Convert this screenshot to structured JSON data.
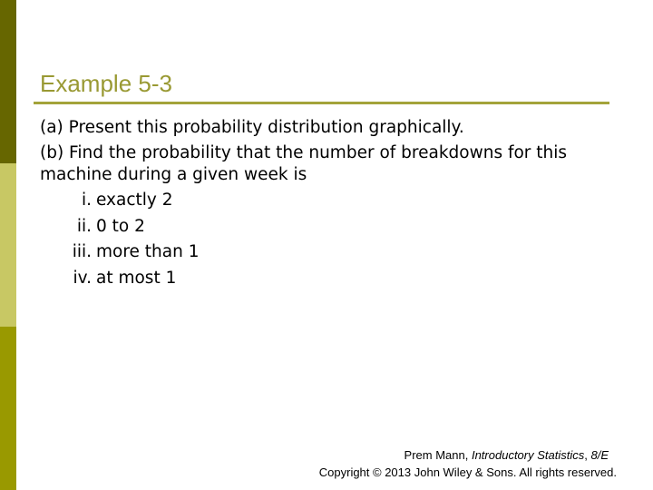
{
  "slide": {
    "title": "Example 5-3",
    "colors": {
      "bar_top": "#666600",
      "bar_middle": "#c8c864",
      "bar_bottom": "#999900",
      "title": "#999933",
      "rule": "#a3a33a"
    },
    "parts": {
      "a": "(a) Present this probability distribution graphically.",
      "b_line1": "(b) Find the probability that the number of breakdowns for this",
      "b_line2": "machine during a given week is"
    },
    "sub_items": [
      {
        "num": "i.",
        "text": "exactly 2"
      },
      {
        "num": "ii.",
        "text": "0 to 2"
      },
      {
        "num": "iii.",
        "text": "more than 1"
      },
      {
        "num": "iv.",
        "text": "at most 1"
      }
    ],
    "footer": {
      "author": "Prem Mann, ",
      "book": "Introductory Statistics",
      "sep": ", ",
      "edition": "8/E",
      "copyright": "Copyright © 2013 John Wiley & Sons. All rights reserved."
    }
  }
}
